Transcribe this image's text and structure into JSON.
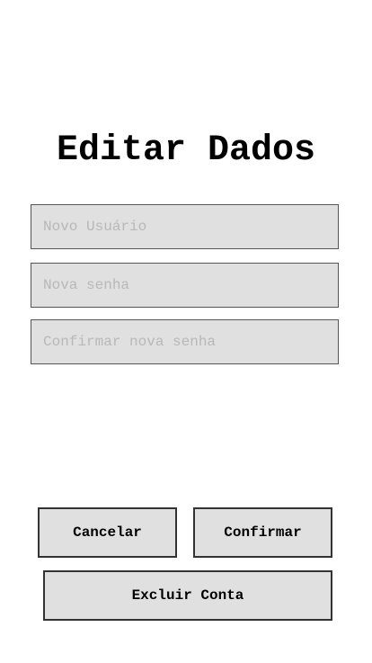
{
  "header": {
    "title": "Editar Dados"
  },
  "form": {
    "username_placeholder": "Novo Usuário",
    "username_value": "",
    "password_placeholder": "Nova senha",
    "password_value": "",
    "confirm_password_placeholder": "Confirmar nova senha",
    "confirm_password_value": ""
  },
  "actions": {
    "cancel_label": "Cancelar",
    "confirm_label": "Confirmar",
    "delete_label": "Excluir Conta"
  },
  "colors": {
    "background": "#ffffff",
    "field_background": "#e0e0e0",
    "placeholder": "#b8b8b8",
    "border": "#333333"
  }
}
